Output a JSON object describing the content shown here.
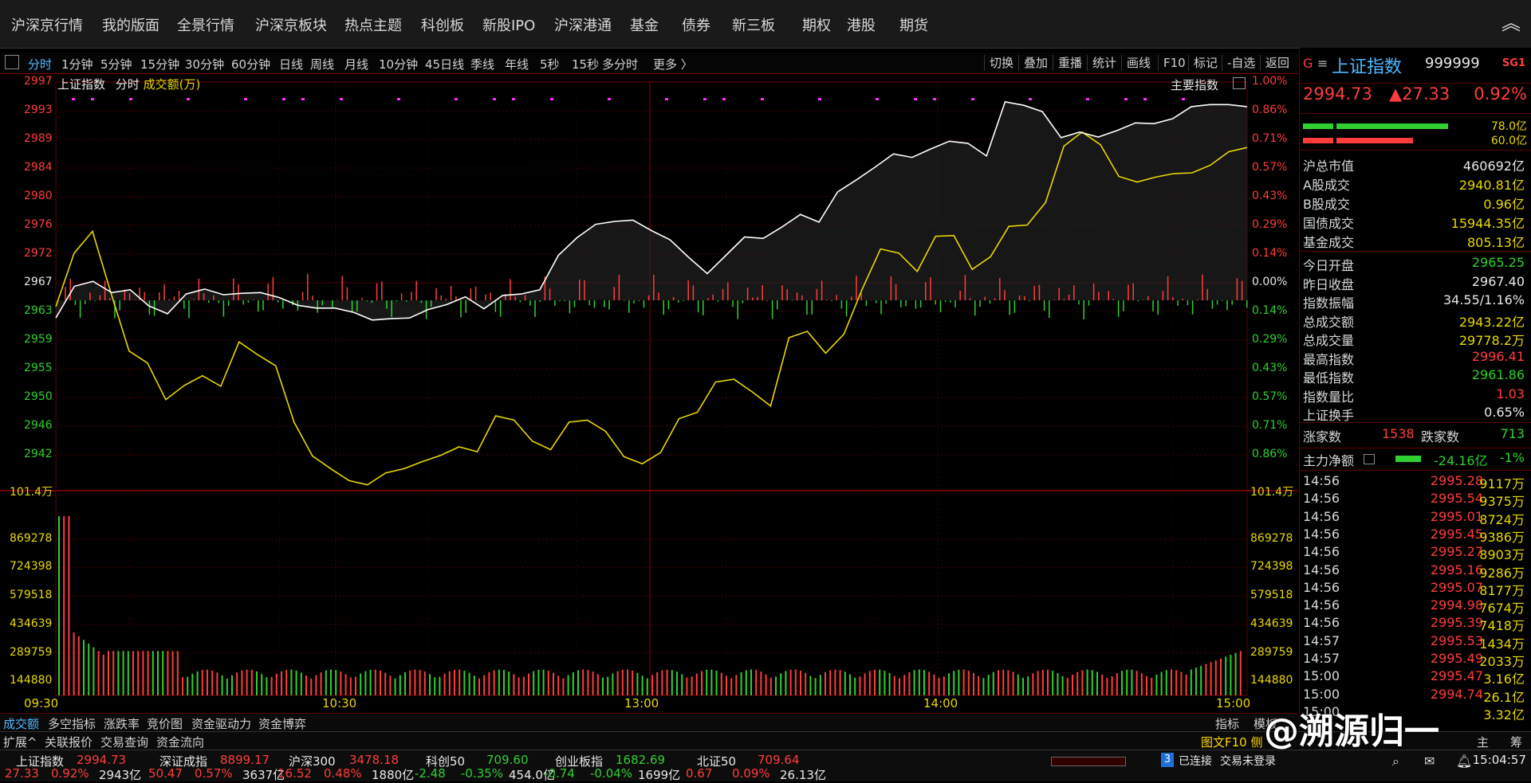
{
  "top_menu": [
    "沪深京行情",
    "我的版面",
    "全景行情",
    "沪深京板块",
    "热点主题",
    "科创板",
    "新股IPO",
    "沪深港通",
    "基金",
    "债券",
    "新三板",
    "期权",
    "港股",
    "期货"
  ],
  "toolbar": {
    "periods": [
      "分时",
      "1分钟",
      "5分钟",
      "15分钟",
      "30分钟",
      "60分钟",
      "日线",
      "周线",
      "月线",
      "10分钟",
      "45日线",
      "季线",
      "年线",
      "5秒",
      "15秒",
      "多分时",
      "更多 〉"
    ],
    "active": "分时",
    "right_buttons": [
      "切换",
      "叠加",
      "重播",
      "统计",
      "画线",
      "F10",
      "标记",
      "-自选",
      "返回"
    ]
  },
  "chart": {
    "header": {
      "name": "上证指数",
      "mode": "分时",
      "volume_label": "成交额(万)",
      "indicator": "主要指数"
    },
    "price_ticks": [
      "2997",
      "2993",
      "2989",
      "2984",
      "2980",
      "2976",
      "2972",
      "2967",
      "2963",
      "2959",
      "2955",
      "2950",
      "2946",
      "2942"
    ],
    "pct_ticks": [
      "1.00%",
      "0.86%",
      "0.71%",
      "0.57%",
      "0.43%",
      "0.29%",
      "0.14%",
      "0.00%",
      "0.14%",
      "0.29%",
      "0.43%",
      "0.57%",
      "0.71%",
      "0.86%"
    ],
    "volume_ticks": [
      "101.4万",
      "869278",
      "724398",
      "579518",
      "434639",
      "289759",
      "144880"
    ],
    "time_ticks": [
      "09:30",
      "10:30",
      "13:00",
      "14:00",
      "15:00"
    ],
    "prev_close": 2967.4,
    "colors": {
      "up": "#ff3c3c",
      "down": "#2fd02f",
      "price_line": "#ffffff",
      "avg_line": "#e8d800",
      "grid": "#4a0000"
    }
  },
  "chart_data": {
    "type": "line",
    "title": "上证指数 分时",
    "ylim": [
      2940.6,
      2998.4
    ],
    "series": [
      {
        "name": "white-line",
        "values": [
          2964.9,
          2969.4,
          2970.1,
          2968.5,
          2968.9,
          2966.6,
          2965.5,
          2968.3,
          2969.0,
          2968.2,
          2968.4,
          2968.5,
          2967.8,
          2966.7,
          2966.3,
          2966.3,
          2965.7,
          2964.6,
          2964.8,
          2964.9,
          2966.1,
          2966.8,
          2967.9,
          2966.2,
          2968.1,
          2968.3,
          2968.9,
          2973.8,
          2976.3,
          2978.2,
          2978.6,
          2978.8,
          2977.3,
          2976.0,
          2973.5,
          2971.2,
          2973.8,
          2976.4,
          2976.2,
          2977.8,
          2979.6,
          2978.5,
          2982.8,
          2984.5,
          2986.3,
          2988.2,
          2987.7,
          2988.9,
          2990.0,
          2989.7,
          2987.9,
          2995.6,
          2995.1,
          2994.2,
          2990.5,
          2991.3,
          2990.6,
          2991.5,
          2992.6,
          2992.5,
          2993.2,
          2994.9,
          2995.2,
          2995.2,
          2994.9
        ]
      },
      {
        "name": "yellow-line",
        "values": [
          2966.5,
          2974.1,
          2977.2,
          2968.5,
          2960.2,
          2958.5,
          2953.3,
          2955.3,
          2956.7,
          2955.2,
          2961.5,
          2959.7,
          2958.1,
          2950.1,
          2945.3,
          2943.5,
          2941.8,
          2941.2,
          2942.9,
          2943.5,
          2944.5,
          2945.4,
          2946.6,
          2945.9,
          2951.0,
          2950.4,
          2947.4,
          2946.2,
          2950.1,
          2950.4,
          2948.8,
          2945.2,
          2944.2,
          2945.8,
          2950.6,
          2951.5,
          2955.8,
          2956.2,
          2954.4,
          2952.4,
          2962.1,
          2963.0,
          2959.9,
          2962.6,
          2969.0,
          2974.7,
          2974.1,
          2971.5,
          2976.5,
          2976.6,
          2971.8,
          2973.6,
          2977.9,
          2978.1,
          2981.3,
          2989.3,
          2991.3,
          2989.5,
          2985.0,
          2984.2,
          2984.9,
          2985.4,
          2985.5,
          2986.6,
          2988.5,
          2989.1
        ]
      }
    ]
  },
  "quote": {
    "flag": "G",
    "name": "上证指数",
    "code": "999999",
    "badge": "SG1",
    "price": "2994.73",
    "change": "▲27.33",
    "pct": "0.92%",
    "bar1_value": "78.0亿",
    "bar2_value": "60.0亿",
    "rows1": [
      {
        "l": "沪总市值",
        "v": "460692亿",
        "c": "white"
      },
      {
        "l": "A股成交",
        "v": "2940.81亿",
        "c": "yellow"
      },
      {
        "l": "B股成交",
        "v": "0.96亿",
        "c": "yellow"
      },
      {
        "l": "国债成交",
        "v": "15944.35亿",
        "c": "yellow"
      },
      {
        "l": "基金成交",
        "v": "805.13亿",
        "c": "yellow"
      }
    ],
    "rows2": [
      {
        "l": "今日开盘",
        "v": "2965.25",
        "c": "green"
      },
      {
        "l": "昨日收盘",
        "v": "2967.40",
        "c": "white"
      },
      {
        "l": "指数振幅",
        "v": "34.55/1.16%",
        "c": "white"
      },
      {
        "l": "总成交额",
        "v": "2943.22亿",
        "c": "yellow"
      },
      {
        "l": "总成交量",
        "v": "29778.2万",
        "c": "yellow"
      },
      {
        "l": "最高指数",
        "v": "2996.41",
        "c": "red"
      },
      {
        "l": "最低指数",
        "v": "2961.86",
        "c": "green"
      },
      {
        "l": "指数量比",
        "v": "1.03",
        "c": "red"
      },
      {
        "l": "上证换手",
        "v": "0.65%",
        "c": "white"
      }
    ],
    "up_label": "涨家数",
    "up_count": "1538",
    "down_label": "跌家数",
    "down_count": "713",
    "flow_label": "主力净额",
    "flow_value": "-24.16亿",
    "flow_pct": "-1%"
  },
  "ticks": [
    {
      "t": "14:56",
      "p": "2995.28",
      "q": "9117万"
    },
    {
      "t": "14:56",
      "p": "2995.54",
      "q": "9375万"
    },
    {
      "t": "14:56",
      "p": "2995.01",
      "q": "8724万"
    },
    {
      "t": "14:56",
      "p": "2995.45",
      "q": "9386万"
    },
    {
      "t": "14:56",
      "p": "2995.27",
      "q": "8903万"
    },
    {
      "t": "14:56",
      "p": "2995.16",
      "q": "9286万"
    },
    {
      "t": "14:56",
      "p": "2995.07",
      "q": "8177万"
    },
    {
      "t": "14:56",
      "p": "2994.98",
      "q": "7674万"
    },
    {
      "t": "14:56",
      "p": "2995.39",
      "q": "7418万"
    },
    {
      "t": "14:57",
      "p": "2995.53",
      "q": "1434万"
    },
    {
      "t": "14:57",
      "p": "2995.49",
      "q": "2033万"
    },
    {
      "t": "15:00",
      "p": "2995.47",
      "q": "3.16亿"
    },
    {
      "t": "15:00",
      "p": "2994.74",
      "q": "26.1亿"
    },
    {
      "t": "15:00",
      "p": "",
      "q": "3.32亿"
    }
  ],
  "bottom_tabs": [
    "成交额",
    "多空指标",
    "涨跌率",
    "竞价图",
    "资金驱动力",
    "资金博弈"
  ],
  "bottom_tabs2": [
    "扩展^",
    "关联报价",
    "交易查询",
    "资金流向"
  ],
  "bottom_right": {
    "indicator": "指标",
    "template": "模板",
    "f10": "图文F10 侧",
    "main": "主",
    "deal": "筹"
  },
  "status": {
    "indices": [
      {
        "name": "上证指数",
        "value": "2994.73",
        "change": "27.33",
        "pct": "0.92%",
        "amount": "2943亿",
        "up": true
      },
      {
        "name": "深证成指",
        "value": "8899.17",
        "change": "50.47",
        "pct": "0.57%",
        "amount": "3637亿",
        "up": true
      },
      {
        "name": "沪深300",
        "value": "3478.18",
        "change": "16.52",
        "pct": "0.48%",
        "amount": "1880亿",
        "up": true
      },
      {
        "name": "科创50",
        "value": "709.60",
        "change": "-2.48",
        "pct": "-0.35%",
        "amount": "454.0亿",
        "up": false
      },
      {
        "name": "创业板指",
        "value": "1682.69",
        "change": "-0.74",
        "pct": "-0.04%",
        "amount": "1699亿",
        "up": false
      },
      {
        "name": "北证50",
        "value": "709.64",
        "change": "0.67",
        "pct": "0.09%",
        "amount": "26.13亿",
        "up": true
      }
    ],
    "conn_badge": "3",
    "conn_text": "已连接",
    "trade_text": "交易未登录",
    "time": "15:04:57"
  },
  "watermark": "@溯源归一"
}
